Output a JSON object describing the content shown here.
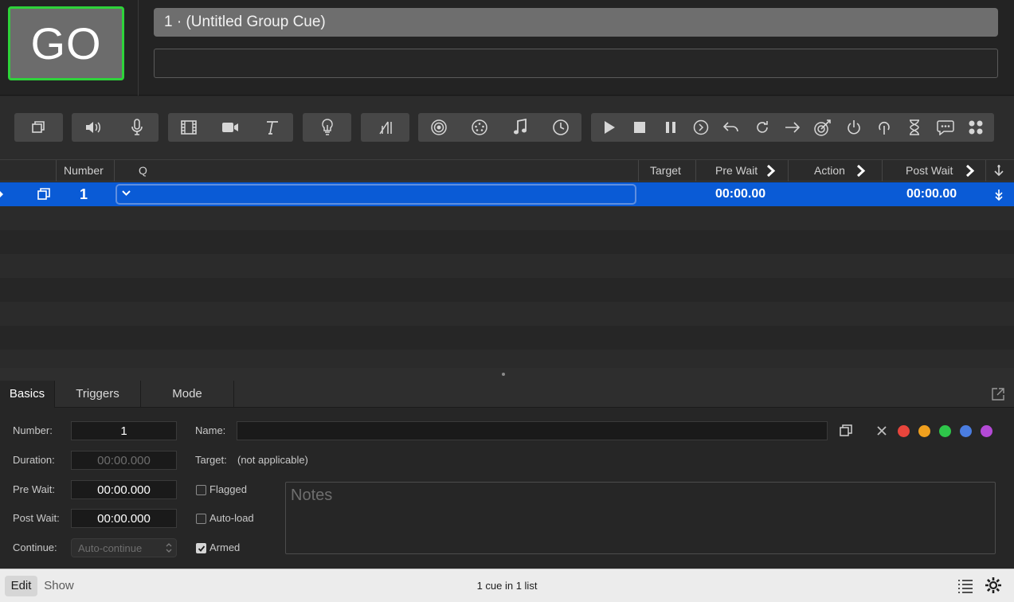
{
  "go_button": {
    "label": "GO"
  },
  "cue_title": "1 · (Untitled Group Cue)",
  "toolbar": {
    "groups": [
      [
        "group-cue-icon"
      ],
      [
        "audio-icon",
        "mic-icon"
      ],
      [
        "video-icon",
        "camera-icon",
        "text-icon"
      ],
      [
        "light-icon"
      ],
      [
        "fade-icon"
      ],
      [
        "network-icon",
        "midi-icon",
        "music-icon",
        "timecode-icon"
      ],
      [
        "start-icon",
        "stop-icon",
        "pause-icon",
        "load-icon",
        "reset-icon",
        "devamp-icon",
        "goto-icon",
        "target-icon",
        "arm-icon",
        "disarm-icon",
        "wait-icon",
        "memo-icon",
        "script-icon"
      ]
    ]
  },
  "table": {
    "headers": {
      "number": "Number",
      "q": "Q",
      "target": "Target",
      "pre_wait": "Pre Wait",
      "action": "Action",
      "post_wait": "Post Wait"
    },
    "rows": [
      {
        "number": "1",
        "name": "",
        "target": "",
        "pre_wait": "00:00.00",
        "action": "",
        "post_wait": "00:00.00",
        "selected": true
      }
    ]
  },
  "inspector": {
    "tabs": [
      "Basics",
      "Triggers",
      "Mode"
    ],
    "active_tab": "Basics",
    "number_label": "Number:",
    "number_value": "1",
    "duration_label": "Duration:",
    "duration_value": "00:00.000",
    "prewait_label": "Pre Wait:",
    "prewait_value": "00:00.000",
    "postwait_label": "Post Wait:",
    "postwait_value": "00:00.000",
    "continue_label": "Continue:",
    "continue_value": "Auto-continue",
    "name_label": "Name:",
    "name_value": "",
    "target_label": "Target:",
    "target_value": "(not applicable)",
    "flagged_label": "Flagged",
    "autoload_label": "Auto-load",
    "armed_label": "Armed",
    "flagged": false,
    "autoload": false,
    "armed": true,
    "notes_placeholder": "Notes",
    "colors": [
      "#e8453c",
      "#f0a01e",
      "#2ec64a",
      "#4a7de0",
      "#b44ad6"
    ]
  },
  "statusbar": {
    "edit_label": "Edit",
    "show_label": "Show",
    "status_text": "1 cue in 1 list"
  }
}
